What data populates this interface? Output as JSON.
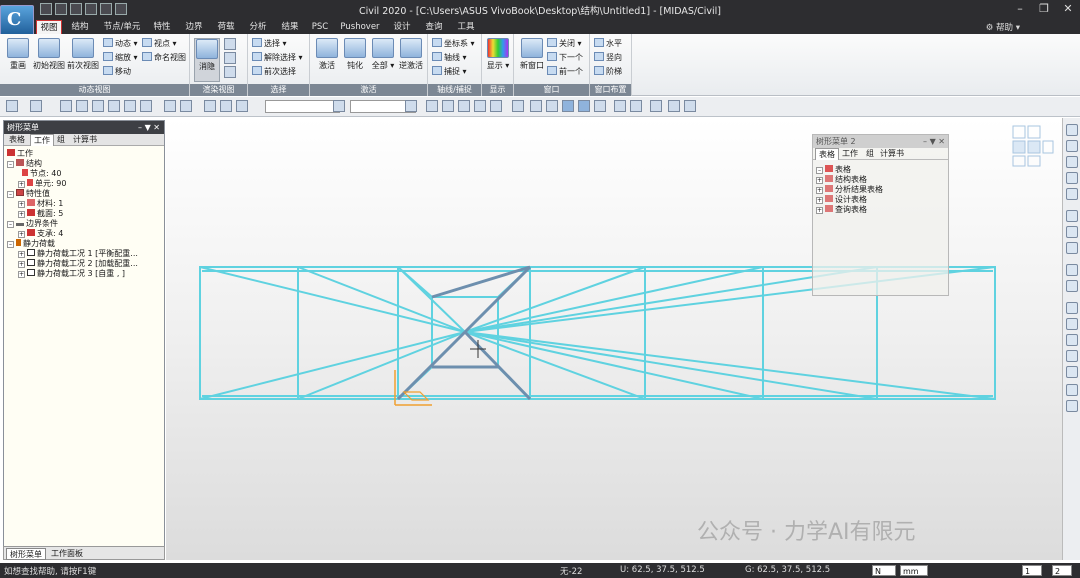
{
  "title_bar": {
    "title": "Civil 2020 - [C:\\Users\\ASUS VivoBook\\Desktop\\结构\\Untitled1] - [MIDAS/Civil]"
  },
  "menu": {
    "tabs": [
      "视图",
      "结构",
      "节点/单元",
      "特性",
      "边界",
      "荷载",
      "分析",
      "结果",
      "PSC",
      "Pushover",
      "设计",
      "查询",
      "工具"
    ],
    "active": "视图",
    "help_label": "帮助"
  },
  "ribbon": {
    "groups": {
      "dynamic_view": "动态视图",
      "render_view": "渲染视图",
      "select": "选择",
      "activate": "激活",
      "axis_snap": "轴线/捕捉",
      "display": "显示",
      "window": "窗口",
      "window_layout": "窗口布置"
    },
    "buttons": {
      "redraw": "重画",
      "initial_view": "初始视图",
      "previous_view": "前次视图",
      "dynamic": "动态",
      "zoom": "缩放",
      "move": "移动",
      "view_point": "视点",
      "named_view": "命名视图",
      "hide": "消隐",
      "select": "选择",
      "deselect": "解除选择",
      "previous_select": "前次选择",
      "activate": "激活",
      "deactivate": "钝化",
      "all": "全部",
      "inverse_activate": "逆激活",
      "coordinate": "坐标系",
      "axis_line": "轴线",
      "snap": "捕捉",
      "display": "显示",
      "new_window": "新窗口",
      "close": "关闭",
      "next": "下一个",
      "previous": "前一个",
      "horizontal": "水平",
      "vertical": "竖向",
      "cascade": "阶梯"
    }
  },
  "left_panel": {
    "title": "树形菜单",
    "tabs": [
      "表格",
      "工作",
      "组",
      "计算书"
    ],
    "active_tab": "工作",
    "tree": [
      {
        "label": "工作",
        "level": 0
      },
      {
        "label": "结构",
        "level": 1
      },
      {
        "label": "节点: 40",
        "level": 2
      },
      {
        "label": "单元: 90",
        "level": 2
      },
      {
        "label": "特性值",
        "level": 1
      },
      {
        "label": "材料: 1",
        "level": 2
      },
      {
        "label": "截面: 5",
        "level": 2
      },
      {
        "label": "边界条件",
        "level": 1
      },
      {
        "label": "支承: 4",
        "level": 2
      },
      {
        "label": "静力荷载",
        "level": 1
      },
      {
        "label": "静力荷载工况 1 [平衡配重...",
        "level": 2
      },
      {
        "label": "静力荷载工况 2 [加载配重...",
        "level": 2
      },
      {
        "label": "静力荷载工况 3 [自重 , ]",
        "level": 2
      }
    ],
    "bottom_tabs": [
      "树形菜单",
      "工作面板"
    ],
    "bottom_active": "树形菜单"
  },
  "float_panel": {
    "title": "树形菜单 2",
    "tabs": [
      "表格",
      "工作",
      "组",
      "计算书"
    ],
    "active_tab": "表格",
    "tree": [
      {
        "label": "表格",
        "level": 0
      },
      {
        "label": "结构表格",
        "level": 1
      },
      {
        "label": "分析结果表格",
        "level": 1
      },
      {
        "label": "设计表格",
        "level": 1
      },
      {
        "label": "查询表格",
        "level": 1
      }
    ]
  },
  "status_bar": {
    "help_text": "如想查找帮助, 请按F1键",
    "node": "无-22",
    "u_coord": "U: 62.5, 37.5, 512.5",
    "g_coord": "G: 62.5, 37.5, 512.5",
    "force_unit": "N",
    "length_unit": "mm",
    "page": "1",
    "page_total": "2"
  },
  "watermark": "公众号 · 力学AI有限元",
  "colors": {
    "member": "#5fd2e0",
    "highlight": "#6d8fae",
    "title_bg": "#2d2d30"
  }
}
